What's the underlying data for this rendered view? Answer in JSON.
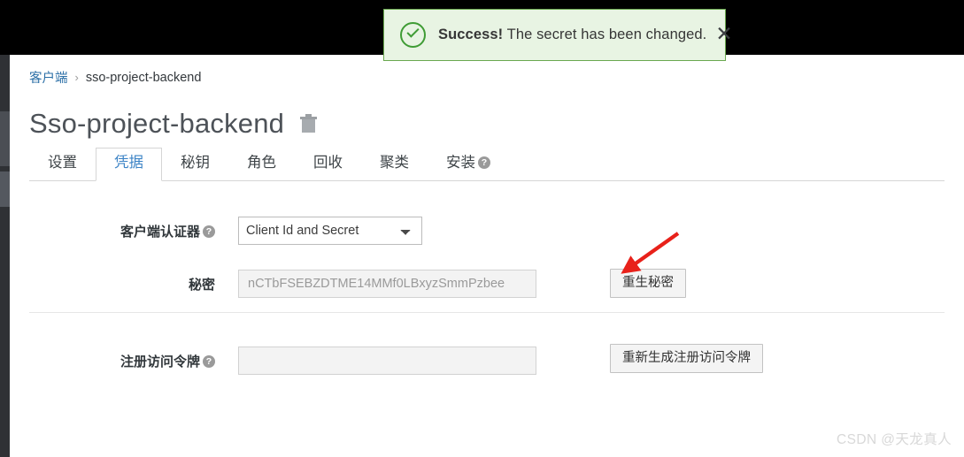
{
  "alert": {
    "icon": "check-circle-icon",
    "strong_text": "Success!",
    "message": " The secret has been changed.",
    "close_label": "✕",
    "bg_color": "#e8f4e3",
    "border_color": "#6aa84f",
    "accent_color": "#3f9c35"
  },
  "breadcrumb": {
    "parent": "客户端",
    "separator": "›",
    "current": "sso-project-backend",
    "link_color": "#2a6ea6"
  },
  "page": {
    "title": "Sso-project-backend",
    "delete_icon": "trash-icon"
  },
  "tabs": [
    {
      "label": "设置",
      "active": false,
      "help": false
    },
    {
      "label": "凭据",
      "active": true,
      "help": false
    },
    {
      "label": "秘钥",
      "active": false,
      "help": false
    },
    {
      "label": "角色",
      "active": false,
      "help": false
    },
    {
      "label": "回收",
      "active": false,
      "help": false
    },
    {
      "label": "聚类",
      "active": false,
      "help": false
    },
    {
      "label": "安装",
      "active": false,
      "help": true
    }
  ],
  "tab_active_color": "#3d84c6",
  "help_glyph": "?",
  "form": {
    "authenticator": {
      "label": "客户端认证器",
      "has_help": true,
      "selected": "Client Id and Secret",
      "options": [
        "Client Id and Secret"
      ]
    },
    "secret": {
      "label": "秘密",
      "has_help": false,
      "value": "nCTbFSEBZDTME14MMf0LBxyzSmmPzbee",
      "button": "重生秘密"
    },
    "registration_token": {
      "label": "注册访问令牌",
      "has_help": true,
      "value": "",
      "button": "重新生成注册访问令牌"
    }
  },
  "annotation": {
    "arrow_color": "#e8211a",
    "points_to": "重生秘密"
  },
  "watermark": {
    "text": "CSDN @天龙真人"
  }
}
